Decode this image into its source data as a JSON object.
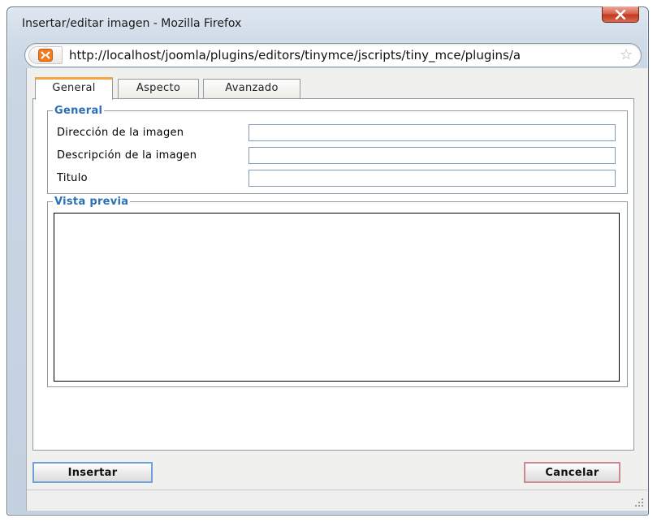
{
  "window": {
    "title": "Insertar/editar imagen - Mozilla Firefox",
    "close_icon": "close-icon"
  },
  "addressbar": {
    "url": "http://localhost/joomla/plugins/editors/tinymce/jscripts/tiny_mce/plugins/a",
    "site_icon": "xampp-site-icon",
    "bookmark_icon": "star-icon"
  },
  "tabs": [
    {
      "label": "General",
      "active": true
    },
    {
      "label": "Aspecto",
      "active": false
    },
    {
      "label": "Avanzado",
      "active": false
    }
  ],
  "general_section": {
    "legend": "General",
    "fields": [
      {
        "label": "Dirección de la imagen",
        "value": ""
      },
      {
        "label": "Descripción de la imagen",
        "value": ""
      },
      {
        "label": "Titulo",
        "value": ""
      }
    ]
  },
  "preview_section": {
    "legend": "Vista previa"
  },
  "buttons": {
    "insert": "Insertar",
    "cancel": "Cancelar"
  },
  "colors": {
    "legend_text": "#2b6fb6",
    "active_tab_accent": "#f7a33e",
    "close_button": "#c0391f"
  }
}
